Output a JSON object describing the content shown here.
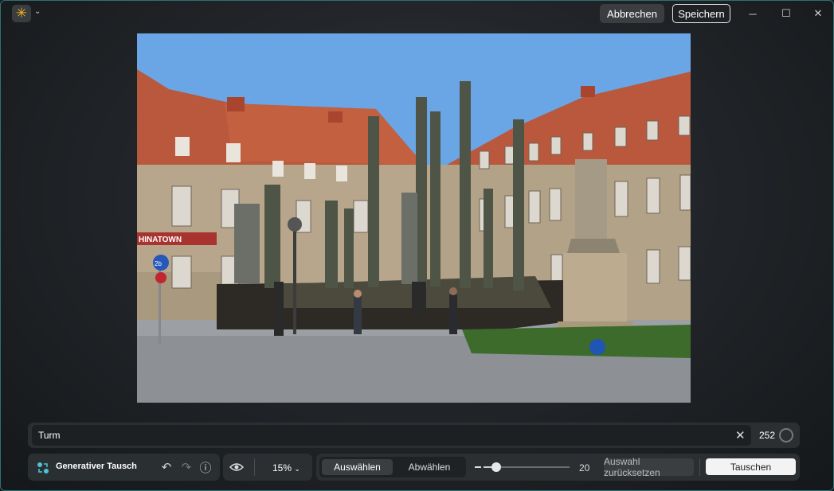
{
  "titlebar": {
    "app_icon": "sun-icon",
    "cancel_label": "Abbrechen",
    "save_label": "Speichern"
  },
  "canvas": {
    "photo_signs": {
      "shop": "HINATOWN",
      "traffic": "2b"
    }
  },
  "prompt": {
    "value": "Turm",
    "count": "252"
  },
  "toolbar": {
    "mode_label": "Generativer Tausch",
    "zoom": "15%",
    "tab_select": "Auswählen",
    "tab_deselect": "Abwählen",
    "brush_size": "20",
    "brush_fraction": 0.15,
    "reset_label": "Auswahl zurücksetzen",
    "swap_label": "Tauschen"
  },
  "colors": {
    "accent": "#f2b320",
    "window_border": "#2f6f73"
  }
}
